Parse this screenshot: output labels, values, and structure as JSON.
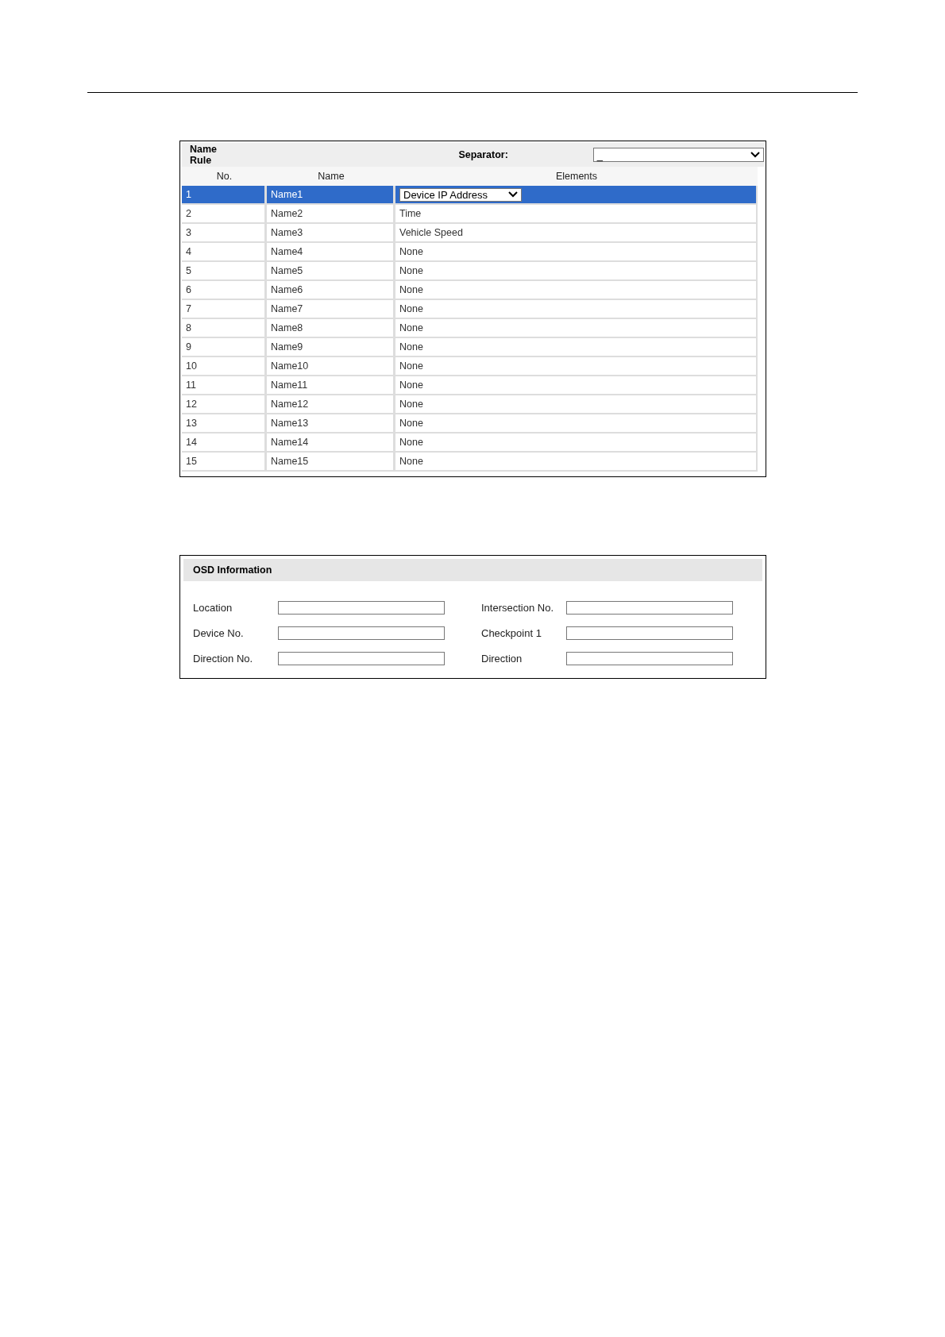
{
  "name_rule": {
    "title": "Name Rule",
    "separator_label": "Separator:",
    "separator_value": "_",
    "columns": [
      "No.",
      "Name",
      "Elements"
    ],
    "rows": [
      {
        "no": "1",
        "name": "Name1",
        "element": "Device IP Address",
        "selected": true
      },
      {
        "no": "2",
        "name": "Name2",
        "element": "Time",
        "selected": false
      },
      {
        "no": "3",
        "name": "Name3",
        "element": "Vehicle Speed",
        "selected": false
      },
      {
        "no": "4",
        "name": "Name4",
        "element": "None",
        "selected": false
      },
      {
        "no": "5",
        "name": "Name5",
        "element": "None",
        "selected": false
      },
      {
        "no": "6",
        "name": "Name6",
        "element": "None",
        "selected": false
      },
      {
        "no": "7",
        "name": "Name7",
        "element": "None",
        "selected": false
      },
      {
        "no": "8",
        "name": "Name8",
        "element": "None",
        "selected": false
      },
      {
        "no": "9",
        "name": "Name9",
        "element": "None",
        "selected": false
      },
      {
        "no": "10",
        "name": "Name10",
        "element": "None",
        "selected": false
      },
      {
        "no": "11",
        "name": "Name11",
        "element": "None",
        "selected": false
      },
      {
        "no": "12",
        "name": "Name12",
        "element": "None",
        "selected": false
      },
      {
        "no": "13",
        "name": "Name13",
        "element": "None",
        "selected": false
      },
      {
        "no": "14",
        "name": "Name14",
        "element": "None",
        "selected": false
      },
      {
        "no": "15",
        "name": "Name15",
        "element": "None",
        "selected": false
      }
    ]
  },
  "osd_information": {
    "title": "OSD Information",
    "fields": [
      {
        "label": "Location"
      },
      {
        "label": "Intersection No."
      },
      {
        "label": "Device No."
      },
      {
        "label": "Checkpoint 1"
      },
      {
        "label": "Direction No."
      },
      {
        "label": "Direction"
      }
    ]
  }
}
